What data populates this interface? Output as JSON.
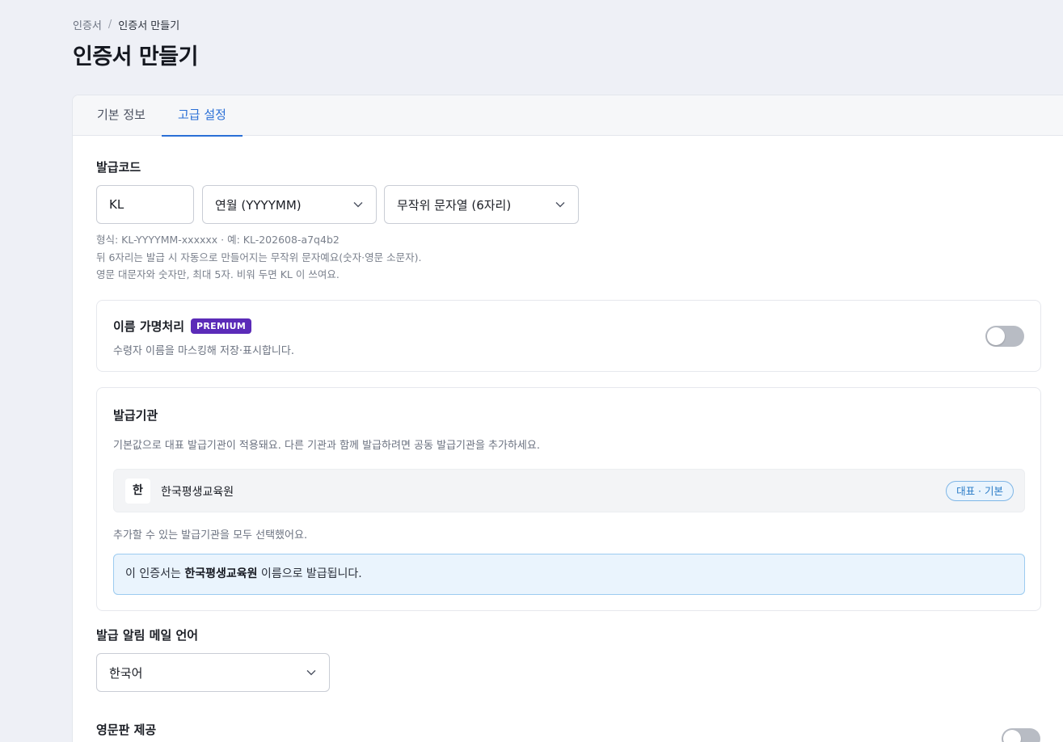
{
  "breadcrumb": {
    "root": "인증서",
    "separator": "/",
    "current": "인증서 만들기"
  },
  "page_title": "인증서 만들기",
  "tabs": [
    {
      "label": "기본 정보",
      "active": false
    },
    {
      "label": "고급 설정",
      "active": true
    }
  ],
  "issue_code": {
    "label": "발급코드",
    "prefix_value": "KL",
    "date_format": "연월 (YYYYMM)",
    "suffix_format": "무작위 문자열 (6자리)",
    "helper_lines": [
      "형식: KL-YYYYMM-xxxxxx · 예: KL-202608-a7q4b2",
      "뒤 6자리는 발급 시 자동으로 만들어지는 무작위 문자예요(숫자·영문 소문자).",
      "영문 대문자와 숫자만, 최대 5자. 비워 두면 KL 이 쓰여요."
    ]
  },
  "anonymize": {
    "title": "이름 가명처리",
    "badge": "PREMIUM",
    "description": "수령자 이름을 마스킹해 저장·표시합니다.",
    "enabled": false
  },
  "issuer": {
    "title": "발급기관",
    "description": "기본값으로 대표 발급기관이 적용돼요. 다른 기관과 함께 발급하려면 공동 발급기관을 추가하세요.",
    "org_initial": "한",
    "org_name": "한국평생교육원",
    "org_badge": "대표 · 기본",
    "all_selected_note": "추가할 수 있는 발급기관을 모두 선택했어요.",
    "info_prefix": "이 인증서는 ",
    "info_org": "한국평생교육원",
    "info_suffix": " 이름으로 발급됩니다."
  },
  "mail_language": {
    "label": "발급 알림 메일 언어",
    "value": "한국어"
  },
  "english_version": {
    "label": "영문판 제공",
    "enabled": false
  },
  "colors": {
    "accent": "#2a6fd6",
    "premium": "#5b2bb8",
    "info_bg": "#eaf4fd",
    "toggle_off": "#b8bcc4"
  }
}
